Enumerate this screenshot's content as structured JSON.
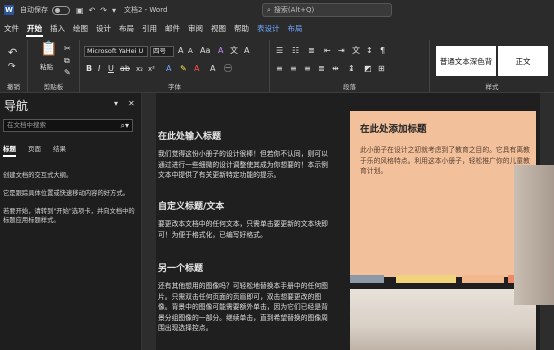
{
  "titlebar": {
    "autosave_label": "自动保存",
    "autosave_state": "关",
    "doc_title": "文档2 - Word",
    "search_placeholder": "搜索(Alt+Q)"
  },
  "menu": {
    "items": [
      "文件",
      "开始",
      "插入",
      "绘图",
      "设计",
      "布局",
      "引用",
      "邮件",
      "审阅",
      "视图",
      "帮助",
      "表设计",
      "布局"
    ]
  },
  "ribbon": {
    "groups": {
      "undo": "撤销",
      "clipboard": "剪贴板",
      "font": "字体",
      "paragraph": "段落",
      "styles": "样式"
    },
    "paste_label": "粘贴",
    "font_name": "Microsoft YaHei U",
    "font_size": "四号",
    "style_cards": [
      "普通文本深色背",
      "正文"
    ]
  },
  "nav": {
    "title": "导航",
    "search_placeholder": "在文档中搜索",
    "tabs": [
      "标题",
      "页面",
      "结果"
    ],
    "p1": "创建文档的交互式大纲。",
    "p2": "它是跟踪具体位置或快速移动内容的好方式。",
    "p3": "若要开始，请转到\"开始\"选项卡，并向文档中的标题应用标题样式。"
  },
  "doc": {
    "h1": "在此处输入标题",
    "p1": "我们觉得这份小册子的设计很棒！但若你不认同，则可以通过进行一些细微的设计调整使其成为你想要的！本示例文本中提供了有关更新特定功能的提示。",
    "h2": "自定义标题/文本",
    "p2": "要更改本文档中的任何文本，只需单击要更新的文本块即可！为便于格式化，已编写好格式。",
    "h3": "另一个标题",
    "p3": "还有其他想用的图像吗？可轻松地替换本手册中的任何图片。只需双击任何页面的页眉即可，双击想要更改的图像。背景中的图像可能需要额外单击，因为它们已经是背景分组图像的一部分。继续单击，直到希望替换的图像周围出现选择控点。",
    "sidebox_title": "在此处添加标题",
    "sidebox_body": "此小册子在设计之初就考虑到了教育之目的。它具有离教于乐的风格特点。利用这本小册子，轻松推广你的儿童教育计划。"
  },
  "colors": {
    "sidebox": "#f2c19c",
    "stripes": [
      "#8b9aa6",
      "#f0d37a",
      "#f3b98e",
      "#f08a66"
    ]
  }
}
